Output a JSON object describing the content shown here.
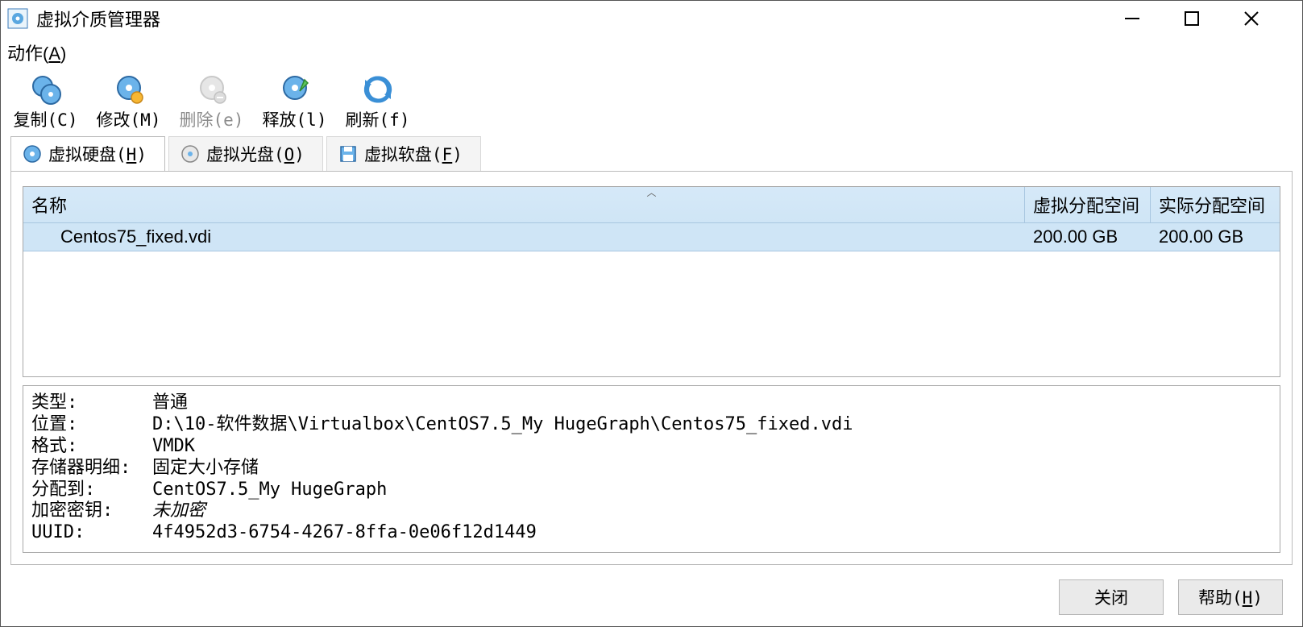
{
  "window": {
    "title": "虚拟介质管理器"
  },
  "menu": {
    "actions": "动作(A)"
  },
  "toolbar": {
    "copy": "复制(C)",
    "modify": "修改(M)",
    "delete": "删除(e)",
    "release": "释放(l)",
    "refresh": "刷新(f)"
  },
  "tabs": {
    "hdd": "虚拟硬盘(H)",
    "optical": "虚拟光盘(O)",
    "floppy": "虚拟软盘(F)"
  },
  "table": {
    "headers": {
      "name": "名称",
      "virtual_size": "虚拟分配空间",
      "actual_size": "实际分配空间"
    },
    "rows": [
      {
        "name": "Centos75_fixed.vdi",
        "virtual_size": "200.00 GB",
        "actual_size": "200.00 GB"
      }
    ]
  },
  "details": {
    "type_label": "类型:",
    "type_value": "普通",
    "location_label": "位置:",
    "location_value": "D:\\10-软件数据\\Virtualbox\\CentOS7.5_My  HugeGraph\\Centos75_fixed.vdi",
    "format_label": "格式:",
    "format_value": "VMDK",
    "storage_label": "存储器明细:",
    "storage_value": "固定大小存储",
    "attached_label": "分配到:",
    "attached_value": "CentOS7.5_My  HugeGraph",
    "encryption_label": "加密密钥:",
    "encryption_value": "未加密",
    "uuid_label": "UUID:",
    "uuid_value": "4f4952d3-6754-4267-8ffa-0e06f12d1449"
  },
  "footer": {
    "close": "关闭",
    "help": "帮助(H)"
  }
}
